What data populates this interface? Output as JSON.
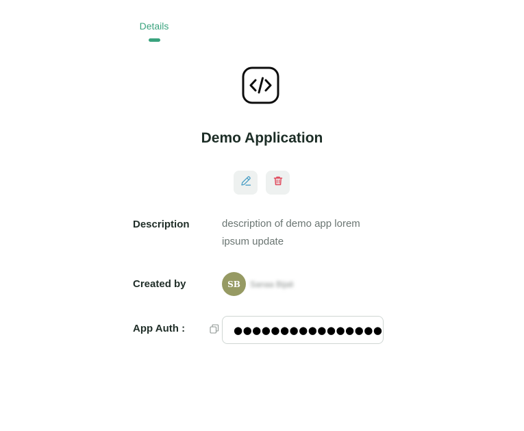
{
  "tabs": [
    {
      "label": "Details",
      "active": true
    }
  ],
  "app": {
    "icon": "code-icon",
    "name": "Demo Application"
  },
  "actions": {
    "edit_icon": "pencil-icon",
    "delete_icon": "trash-icon",
    "edit_color": "#4a9fc6",
    "delete_color": "#e0475a"
  },
  "details": {
    "description_label": "Description",
    "description_value": "description of demo app lorem ipsum update",
    "created_by_label": "Created by",
    "creator_initials": "SB",
    "creator_name": "Sanaa Bijali",
    "app_auth_label": "App Auth :",
    "app_auth_value": "●●●●●●●●●●●●●●●●●●●●●●",
    "copy_icon": "copy-icon"
  },
  "colors": {
    "accent": "#3aa37e",
    "avatar_bg": "#969a63"
  }
}
